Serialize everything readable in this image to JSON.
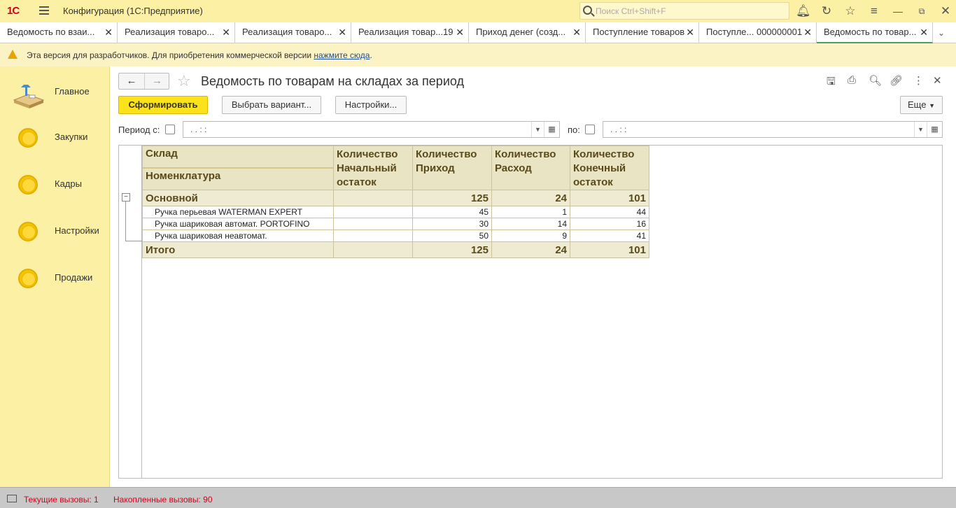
{
  "app": {
    "logo": "1С",
    "title": "Конфигурация  (1С:Предприятие)",
    "search_placeholder": "Поиск Ctrl+Shift+F"
  },
  "tabs": [
    {
      "label": "Ведомость по взаи..."
    },
    {
      "label": "Реализация товаро..."
    },
    {
      "label": "Реализация товаро..."
    },
    {
      "label": "Реализация товар...19"
    },
    {
      "label": "Приход денег (созд..."
    },
    {
      "label": "Поступление товаров"
    },
    {
      "label": "Поступле... 000000001"
    },
    {
      "label": "Ведомость по товар..."
    }
  ],
  "notice": {
    "text": "Эта версия для разработчиков. Для приобретения коммерческой версии ",
    "link": "нажмите сюда",
    "tail": "."
  },
  "sidebar": {
    "items": [
      {
        "label": "Главное"
      },
      {
        "label": "Закупки"
      },
      {
        "label": "Кадры"
      },
      {
        "label": "Настройки"
      },
      {
        "label": "Продажи"
      }
    ]
  },
  "form": {
    "title": "Ведомость по товарам на складах за период",
    "generate_label": "Сформировать",
    "variant_label": "Выбрать вариант...",
    "settings_label": "Настройки...",
    "more_label": "Еще",
    "period_from_label": "Период с:",
    "period_to_label": "по:",
    "date_from": " .  .       :  :",
    "date_to": " .  .       :  :"
  },
  "report": {
    "header": {
      "col1_line1": "Склад",
      "col1_line2": "Номенклатура",
      "col2": "Количество Начальный остаток",
      "col3": "Количество Приход",
      "col4": "Количество Расход",
      "col5": "Количество Конечный остаток"
    },
    "group": {
      "name": "Основной",
      "start": "",
      "in": "125",
      "out": "24",
      "end": "101"
    },
    "rows": [
      {
        "name": "Ручка перьевая WATERMAN EXPERT",
        "start": "",
        "in": "45",
        "out": "1",
        "end": "44"
      },
      {
        "name": "Ручка шариковая автомат. PORTOFINO",
        "start": "",
        "in": "30",
        "out": "14",
        "end": "16"
      },
      {
        "name": "Ручка шариковая неавтомат.",
        "start": "",
        "in": "50",
        "out": "9",
        "end": "41"
      }
    ],
    "total": {
      "name": "Итого",
      "start": "",
      "in": "125",
      "out": "24",
      "end": "101"
    }
  },
  "status": {
    "current_calls": "Текущие вызовы: 1",
    "accumulated_calls": "Накопленные вызовы: 90"
  }
}
